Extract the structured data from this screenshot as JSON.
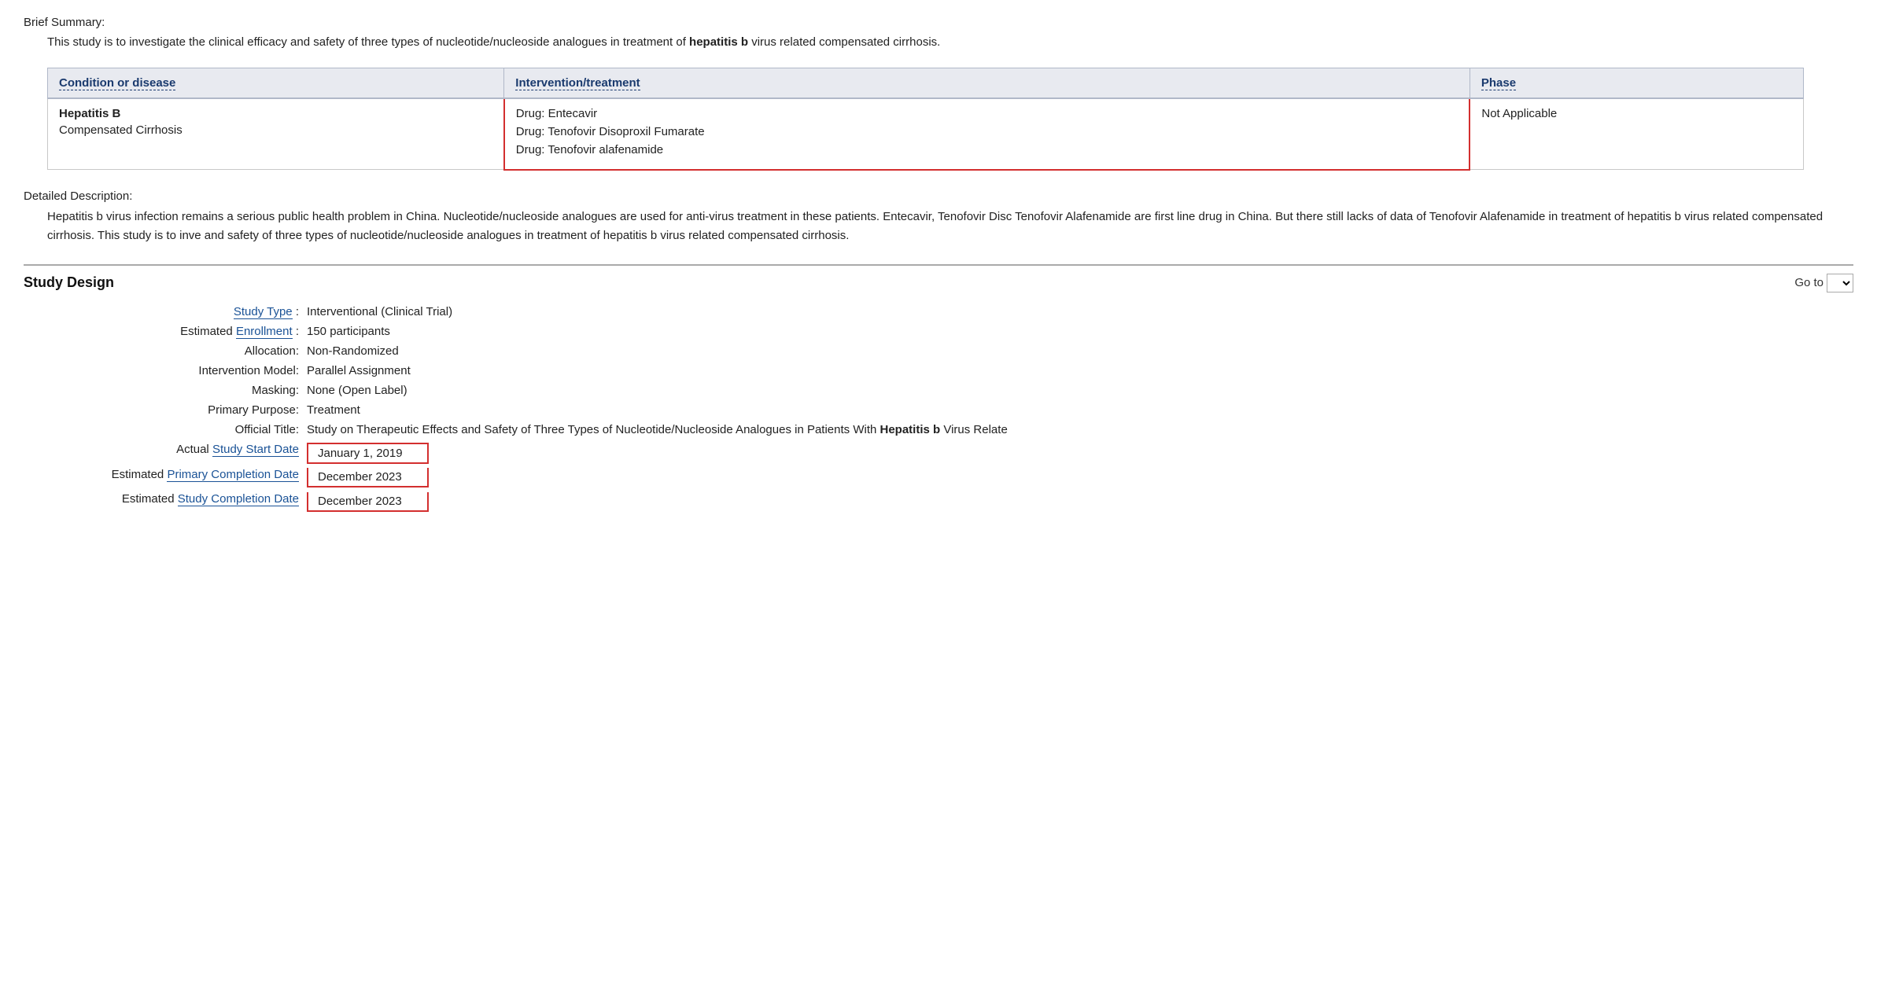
{
  "brief_summary": {
    "label": "Brief Summary:",
    "text_parts": [
      "This study is to investigate the clinical efficacy and safety of three types of nucleotide/nucleoside analogues in treatment of ",
      "hepatitis b",
      " virus related compensated cirrhosis."
    ]
  },
  "table": {
    "headers": {
      "condition": "Condition or disease",
      "intervention": "Intervention/treatment",
      "phase": "Phase"
    },
    "rows": [
      {
        "conditions": [
          "Hepatitis B",
          "Compensated Cirrhosis"
        ],
        "interventions": [
          "Drug: Entecavir",
          "Drug: Tenofovir Disoproxil Fumarate",
          "Drug: Tenofovir alafenamide"
        ],
        "phase": "Not Applicable"
      }
    ]
  },
  "detailed_description": {
    "label": "Detailed Description:",
    "text": "Hepatitis b virus infection remains a serious public health problem in China. Nucleotide/nucleoside analogues are used for anti-virus treatment in these patients. Entecavir, Tenofovir Disc Tenofovir Alafenamide are first line drug in China. But there still lacks of data of Tenofovir Alafenamide in treatment of hepatitis b virus related compensated cirrhosis. This study is to inve and safety of three types of nucleotide/nucleoside analogues in treatment of hepatitis b virus related compensated cirrhosis."
  },
  "study_design": {
    "section_title": "Study Design",
    "goto_label": "Go to",
    "fields": [
      {
        "label": "Study Type :",
        "label_linked": "Study Type",
        "value": "Interventional  (Clinical Trial)",
        "has_link": true
      },
      {
        "label": "Estimated Enrollment :",
        "label_linked": "Enrollment",
        "value": "150 participants",
        "has_link": true
      },
      {
        "label": "Allocation:",
        "label_linked": null,
        "value": "Non-Randomized",
        "has_link": false
      },
      {
        "label": "Intervention Model:",
        "label_linked": null,
        "value": "Parallel Assignment",
        "has_link": false
      },
      {
        "label": "Masking:",
        "label_linked": null,
        "value": "None (Open Label)",
        "has_link": false
      },
      {
        "label": "Primary Purpose:",
        "label_linked": null,
        "value": "Treatment",
        "has_link": false
      },
      {
        "label": "Official Title:",
        "label_linked": null,
        "value": "Study on Therapeutic Effects and Safety of Three Types of Nucleotide/Nucleoside Analogues in Patients With Hepatitis b Virus Relate",
        "has_link": false,
        "bold_part": "Hepatitis b"
      }
    ],
    "dates": [
      {
        "label": "Actual",
        "label_link": "Study Start Date",
        "value": "January 1, 2019"
      },
      {
        "label": "Estimated",
        "label_link": "Primary Completion Date",
        "value": "December 2023"
      },
      {
        "label": "Estimated",
        "label_link": "Study Completion Date",
        "value": "December 2023"
      }
    ]
  }
}
